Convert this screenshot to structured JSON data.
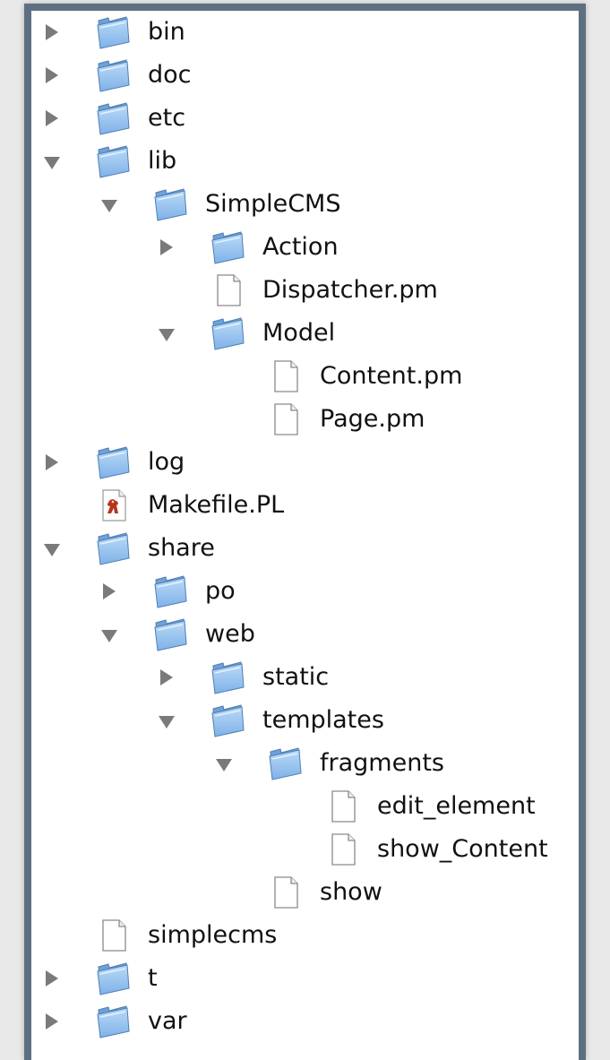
{
  "colors": {
    "frame": "#5f6f82",
    "folder_blue": "#7fb2e8",
    "triangle": "#7a7a7a",
    "background": "#e9e9e9"
  },
  "tree": [
    {
      "label": "bin",
      "type": "folder",
      "expander": "collapsed",
      "depth": 0
    },
    {
      "label": "doc",
      "type": "folder",
      "expander": "collapsed",
      "depth": 0
    },
    {
      "label": "etc",
      "type": "folder",
      "expander": "collapsed",
      "depth": 0
    },
    {
      "label": "lib",
      "type": "folder",
      "expander": "expanded",
      "depth": 0
    },
    {
      "label": "SimpleCMS",
      "type": "folder",
      "expander": "expanded",
      "depth": 1
    },
    {
      "label": "Action",
      "type": "folder",
      "expander": "collapsed",
      "depth": 2
    },
    {
      "label": "Dispatcher.pm",
      "type": "file",
      "expander": "none",
      "depth": 2
    },
    {
      "label": "Model",
      "type": "folder",
      "expander": "expanded",
      "depth": 2
    },
    {
      "label": "Content.pm",
      "type": "file",
      "expander": "none",
      "depth": 3
    },
    {
      "label": "Page.pm",
      "type": "file",
      "expander": "none",
      "depth": 3
    },
    {
      "label": "log",
      "type": "folder",
      "expander": "collapsed",
      "depth": 0
    },
    {
      "label": "Makefile.PL",
      "type": "perl-script",
      "expander": "none",
      "depth": 0
    },
    {
      "label": "share",
      "type": "folder",
      "expander": "expanded",
      "depth": 0
    },
    {
      "label": "po",
      "type": "folder",
      "expander": "collapsed",
      "depth": 1
    },
    {
      "label": "web",
      "type": "folder",
      "expander": "expanded",
      "depth": 1
    },
    {
      "label": "static",
      "type": "folder",
      "expander": "collapsed",
      "depth": 2
    },
    {
      "label": "templates",
      "type": "folder",
      "expander": "expanded",
      "depth": 2
    },
    {
      "label": "fragments",
      "type": "folder",
      "expander": "expanded",
      "depth": 3
    },
    {
      "label": "edit_element",
      "type": "file",
      "expander": "none",
      "depth": 4
    },
    {
      "label": "show_Content",
      "type": "file",
      "expander": "none",
      "depth": 4
    },
    {
      "label": "show",
      "type": "file",
      "expander": "none",
      "depth": 3
    },
    {
      "label": "simplecms",
      "type": "file",
      "expander": "none",
      "depth": 0
    },
    {
      "label": "t",
      "type": "folder",
      "expander": "collapsed",
      "depth": 0
    },
    {
      "label": "var",
      "type": "folder",
      "expander": "collapsed",
      "depth": 0
    }
  ]
}
